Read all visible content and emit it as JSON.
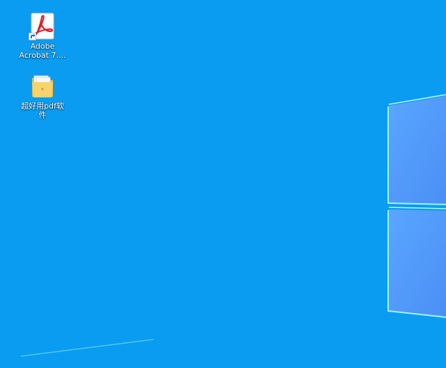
{
  "desktop": {
    "background_color": "#0a9cf0",
    "wallpaper": "windows-10-logo-light",
    "icons": [
      {
        "label_line1": "Adobe",
        "label_line2": "Acrobat 7....",
        "icon": "adobe-acrobat-icon",
        "shortcut": true
      },
      {
        "label_line1": "超好用pdf软",
        "label_line2": "件",
        "icon": "folder-icon",
        "shortcut": false
      }
    ]
  }
}
